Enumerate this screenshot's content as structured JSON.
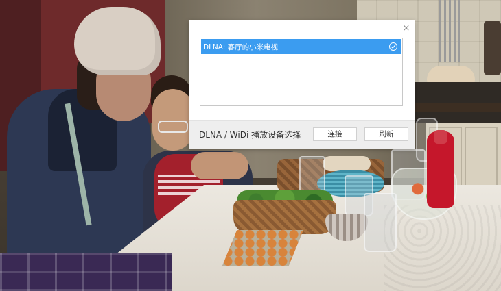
{
  "dialog": {
    "close_glyph": "×",
    "devices": [
      {
        "label": "DLNA: 客厅的小米电视",
        "selected": true
      }
    ],
    "footer_title": "DLNA / WiDi 播放设备选择",
    "connect_label": "连接",
    "refresh_label": "刷新"
  },
  "colors": {
    "selection": "#3b9cf0",
    "dialog_bg": "#ffffff",
    "footer_bg": "#eeeeee"
  },
  "icons": {
    "close": "close-icon",
    "selected": "check-circle-icon"
  }
}
